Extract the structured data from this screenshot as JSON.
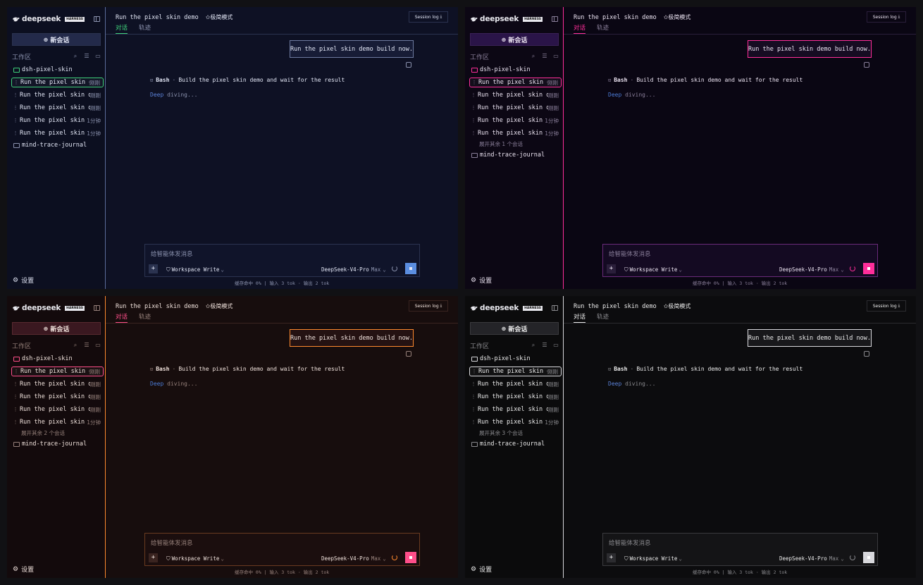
{
  "common": {
    "brand": "deepseek",
    "harness_badge": "HARNESS",
    "new_chat": "新会话",
    "workspace_label": "工作区",
    "folder_open": "dsh-pixel-skin",
    "folder_closed": "mind-trace-journal",
    "settings": "设置",
    "chat_title": "Run the pixel skin demo",
    "mode_label": "极简模式",
    "tab_chat": "对话",
    "tab_trace": "轨迹",
    "session_log": "Session log",
    "user_message": "Run the pixel skin demo build now.",
    "tool_name": "Bash",
    "tool_sep": "·",
    "tool_desc": "Build the pixel skin demo and wait for the result",
    "deep_diving_a": "Deep",
    "deep_diving_b": "diving...",
    "composer_placeholder": "给智能体发消息",
    "workspace_write": "Workspace Write",
    "model": "DeepSeek-V4-Pro",
    "model_tier": "Max",
    "footer": "缓存命中 0% | 输入 3 tok · 输出 2 tok",
    "icons": {
      "logo": "whale-icon",
      "collapse": "sidebar-collapse-icon",
      "new_chat": "plus-circle-icon",
      "search": "search-icon",
      "filter": "filter-icon",
      "new_folder": "new-folder-icon",
      "folder": "folder-icon",
      "settings": "gear-icon",
      "mode": "sparkle-icon",
      "download": "download-icon",
      "copy": "copy-icon",
      "tool": "terminal-icon",
      "add": "plus-icon",
      "shield": "shield-icon",
      "chevron": "chevron-down-icon",
      "spinner": "spinner-icon",
      "send": "stop-icon"
    }
  },
  "themes": [
    {
      "id": "navy",
      "colors": {
        "accent": "#5b6c9a",
        "active": "#3fd07a",
        "send": "#5b8ee0",
        "background": "#0e1124"
      },
      "sessions": [
        {
          "title": "Run the pixel skin d…",
          "time": "刚刚"
        },
        {
          "title": "Run the pixel skin d…",
          "time": "刚刚"
        },
        {
          "title": "Run the pixel skin d…",
          "time": "刚刚"
        },
        {
          "title": "Run the pixel skin …",
          "time": "1分钟"
        },
        {
          "title": "Run the pixel skin …",
          "time": "1分钟"
        }
      ],
      "expand_more": ""
    },
    {
      "id": "magenta",
      "colors": {
        "accent": "#ff2e9a",
        "active": "#ff2e9a",
        "send": "#ff2e9a",
        "background": "#0a0613"
      },
      "sessions": [
        {
          "title": "Run the pixel skin d…",
          "time": "刚刚"
        },
        {
          "title": "Run the pixel skin d…",
          "time": "刚刚"
        },
        {
          "title": "Run the pixel skin d…",
          "time": "刚刚"
        },
        {
          "title": "Run the pixel skin …",
          "time": "1分钟"
        },
        {
          "title": "Run the pixel skin …",
          "time": "1分钟"
        }
      ],
      "expand_more": "展开其余 1 个会话"
    },
    {
      "id": "ember",
      "colors": {
        "accent": "#ff8a2e",
        "active": "#ff4f8a",
        "send": "#ff4f8a",
        "background": "#170d0d"
      },
      "sessions": [
        {
          "title": "Run the pixel skin d…",
          "time": "刚刚"
        },
        {
          "title": "Run the pixel skin d…",
          "time": "刚刚"
        },
        {
          "title": "Run the pixel skin d…",
          "time": "刚刚"
        },
        {
          "title": "Run the pixel skin d…",
          "time": "刚刚"
        },
        {
          "title": "Run the pixel skin …",
          "time": "1分钟"
        }
      ],
      "expand_more": "展开其余 2 个会话"
    },
    {
      "id": "mono",
      "colors": {
        "accent": "#d8d8dc",
        "active": "#d8d8dc",
        "send": "#d8d8dc",
        "background": "#0c0c0e"
      },
      "sessions": [
        {
          "title": "Run the pixel skin d…",
          "time": "刚刚"
        },
        {
          "title": "Run the pixel skin d…",
          "time": "刚刚"
        },
        {
          "title": "Run the pixel skin d…",
          "time": "刚刚"
        },
        {
          "title": "Run the pixel skin d…",
          "time": "刚刚"
        },
        {
          "title": "Run the pixel skin …",
          "time": "1分钟"
        }
      ],
      "expand_more": "展开其余 3 个会话"
    }
  ]
}
